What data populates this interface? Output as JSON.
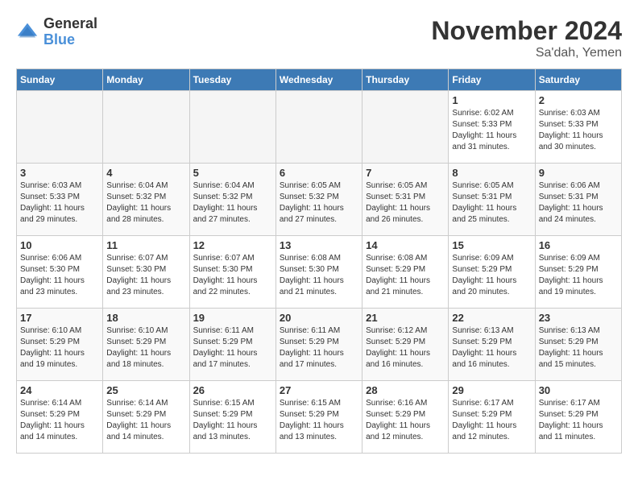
{
  "header": {
    "logo_general": "General",
    "logo_blue": "Blue",
    "month_title": "November 2024",
    "location": "Sa'dah, Yemen"
  },
  "weekdays": [
    "Sunday",
    "Monday",
    "Tuesday",
    "Wednesday",
    "Thursday",
    "Friday",
    "Saturday"
  ],
  "weeks": [
    [
      {
        "day": "",
        "info": ""
      },
      {
        "day": "",
        "info": ""
      },
      {
        "day": "",
        "info": ""
      },
      {
        "day": "",
        "info": ""
      },
      {
        "day": "",
        "info": ""
      },
      {
        "day": "1",
        "info": "Sunrise: 6:02 AM\nSunset: 5:33 PM\nDaylight: 11 hours and 31 minutes."
      },
      {
        "day": "2",
        "info": "Sunrise: 6:03 AM\nSunset: 5:33 PM\nDaylight: 11 hours and 30 minutes."
      }
    ],
    [
      {
        "day": "3",
        "info": "Sunrise: 6:03 AM\nSunset: 5:33 PM\nDaylight: 11 hours and 29 minutes."
      },
      {
        "day": "4",
        "info": "Sunrise: 6:04 AM\nSunset: 5:32 PM\nDaylight: 11 hours and 28 minutes."
      },
      {
        "day": "5",
        "info": "Sunrise: 6:04 AM\nSunset: 5:32 PM\nDaylight: 11 hours and 27 minutes."
      },
      {
        "day": "6",
        "info": "Sunrise: 6:05 AM\nSunset: 5:32 PM\nDaylight: 11 hours and 27 minutes."
      },
      {
        "day": "7",
        "info": "Sunrise: 6:05 AM\nSunset: 5:31 PM\nDaylight: 11 hours and 26 minutes."
      },
      {
        "day": "8",
        "info": "Sunrise: 6:05 AM\nSunset: 5:31 PM\nDaylight: 11 hours and 25 minutes."
      },
      {
        "day": "9",
        "info": "Sunrise: 6:06 AM\nSunset: 5:31 PM\nDaylight: 11 hours and 24 minutes."
      }
    ],
    [
      {
        "day": "10",
        "info": "Sunrise: 6:06 AM\nSunset: 5:30 PM\nDaylight: 11 hours and 23 minutes."
      },
      {
        "day": "11",
        "info": "Sunrise: 6:07 AM\nSunset: 5:30 PM\nDaylight: 11 hours and 23 minutes."
      },
      {
        "day": "12",
        "info": "Sunrise: 6:07 AM\nSunset: 5:30 PM\nDaylight: 11 hours and 22 minutes."
      },
      {
        "day": "13",
        "info": "Sunrise: 6:08 AM\nSunset: 5:30 PM\nDaylight: 11 hours and 21 minutes."
      },
      {
        "day": "14",
        "info": "Sunrise: 6:08 AM\nSunset: 5:29 PM\nDaylight: 11 hours and 21 minutes."
      },
      {
        "day": "15",
        "info": "Sunrise: 6:09 AM\nSunset: 5:29 PM\nDaylight: 11 hours and 20 minutes."
      },
      {
        "day": "16",
        "info": "Sunrise: 6:09 AM\nSunset: 5:29 PM\nDaylight: 11 hours and 19 minutes."
      }
    ],
    [
      {
        "day": "17",
        "info": "Sunrise: 6:10 AM\nSunset: 5:29 PM\nDaylight: 11 hours and 19 minutes."
      },
      {
        "day": "18",
        "info": "Sunrise: 6:10 AM\nSunset: 5:29 PM\nDaylight: 11 hours and 18 minutes."
      },
      {
        "day": "19",
        "info": "Sunrise: 6:11 AM\nSunset: 5:29 PM\nDaylight: 11 hours and 17 minutes."
      },
      {
        "day": "20",
        "info": "Sunrise: 6:11 AM\nSunset: 5:29 PM\nDaylight: 11 hours and 17 minutes."
      },
      {
        "day": "21",
        "info": "Sunrise: 6:12 AM\nSunset: 5:29 PM\nDaylight: 11 hours and 16 minutes."
      },
      {
        "day": "22",
        "info": "Sunrise: 6:13 AM\nSunset: 5:29 PM\nDaylight: 11 hours and 16 minutes."
      },
      {
        "day": "23",
        "info": "Sunrise: 6:13 AM\nSunset: 5:29 PM\nDaylight: 11 hours and 15 minutes."
      }
    ],
    [
      {
        "day": "24",
        "info": "Sunrise: 6:14 AM\nSunset: 5:29 PM\nDaylight: 11 hours and 14 minutes."
      },
      {
        "day": "25",
        "info": "Sunrise: 6:14 AM\nSunset: 5:29 PM\nDaylight: 11 hours and 14 minutes."
      },
      {
        "day": "26",
        "info": "Sunrise: 6:15 AM\nSunset: 5:29 PM\nDaylight: 11 hours and 13 minutes."
      },
      {
        "day": "27",
        "info": "Sunrise: 6:15 AM\nSunset: 5:29 PM\nDaylight: 11 hours and 13 minutes."
      },
      {
        "day": "28",
        "info": "Sunrise: 6:16 AM\nSunset: 5:29 PM\nDaylight: 11 hours and 12 minutes."
      },
      {
        "day": "29",
        "info": "Sunrise: 6:17 AM\nSunset: 5:29 PM\nDaylight: 11 hours and 12 minutes."
      },
      {
        "day": "30",
        "info": "Sunrise: 6:17 AM\nSunset: 5:29 PM\nDaylight: 11 hours and 11 minutes."
      }
    ]
  ]
}
